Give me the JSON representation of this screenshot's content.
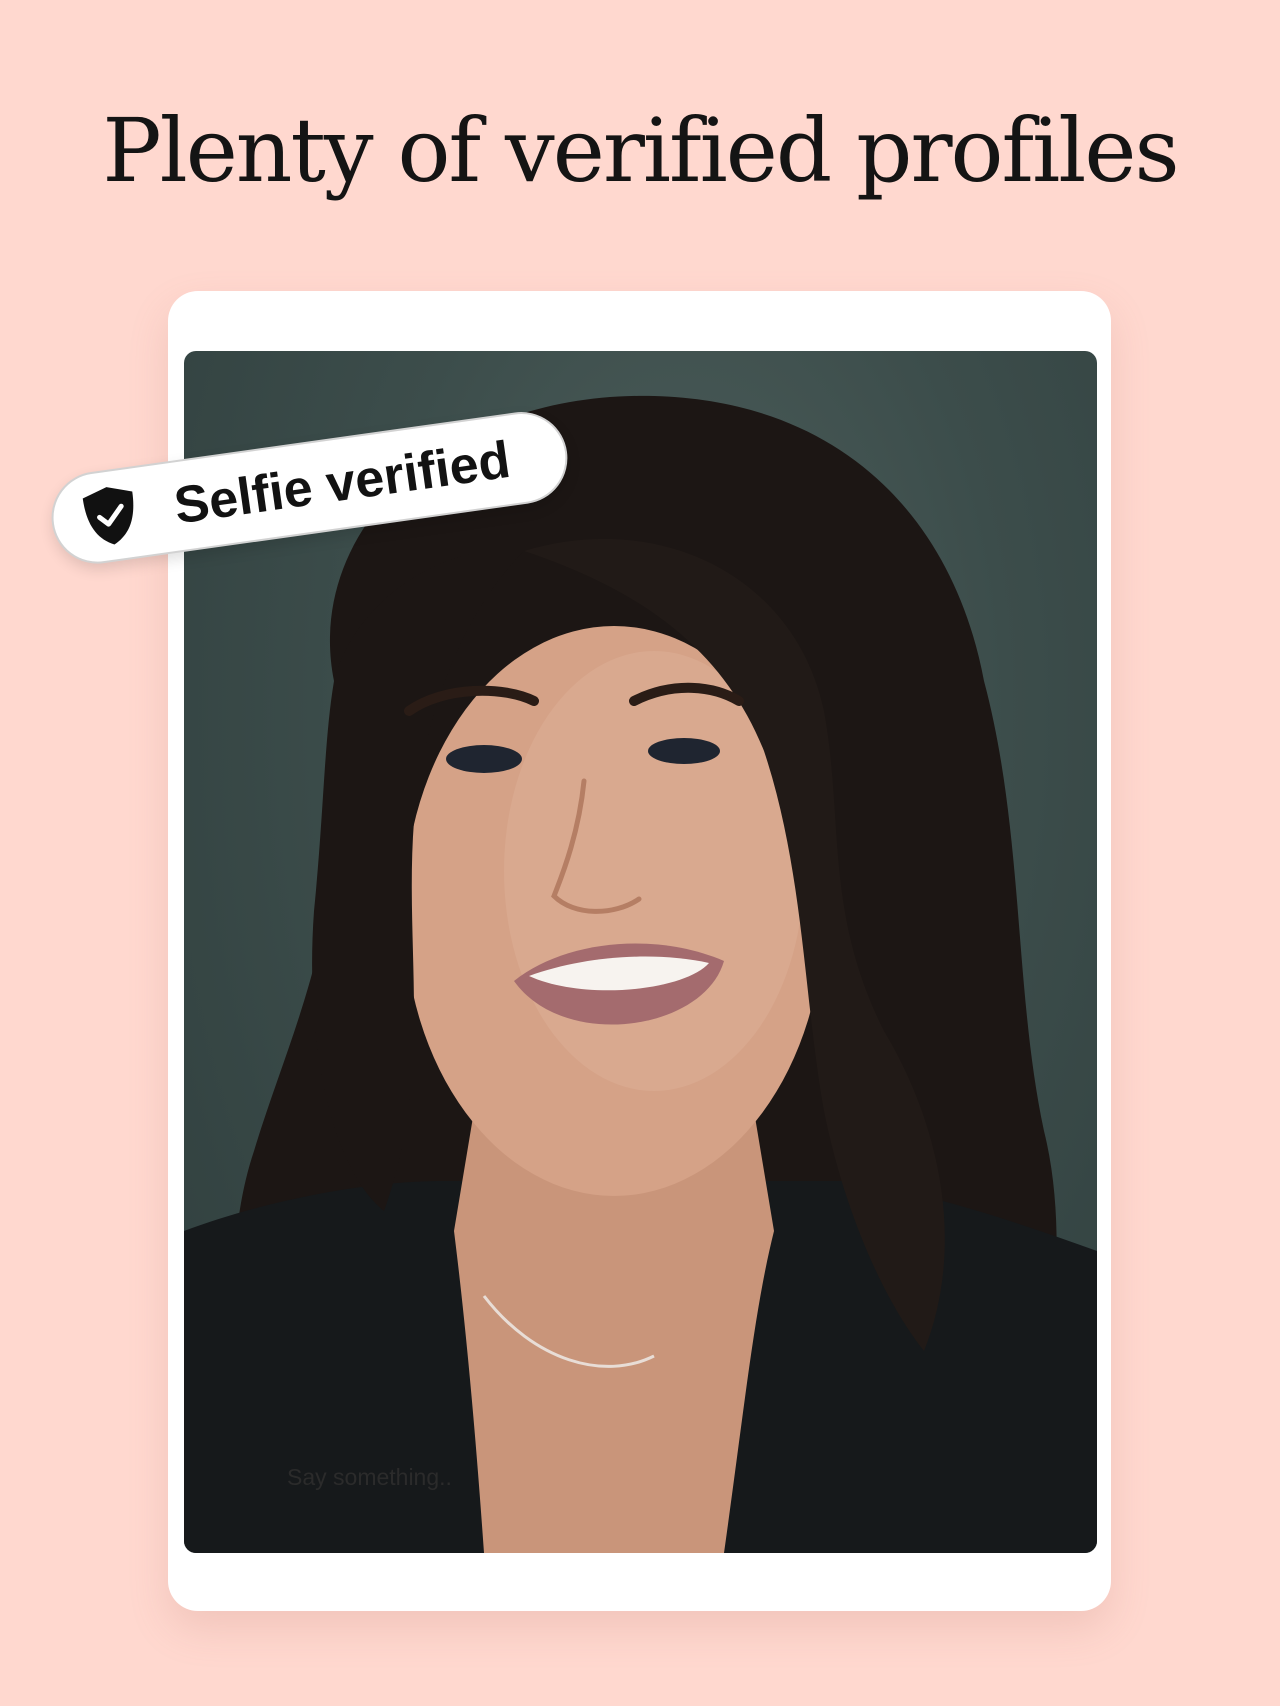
{
  "headline": "Plenty of verified profiles",
  "badge": {
    "label": "Selfie verified",
    "icon": "shield-check-icon"
  },
  "profile": {
    "photo": "profile-photo",
    "comment_placeholder": "Say something.."
  },
  "colors": {
    "background": "#ffd8cf",
    "card": "#ffffff",
    "text": "#141414"
  }
}
